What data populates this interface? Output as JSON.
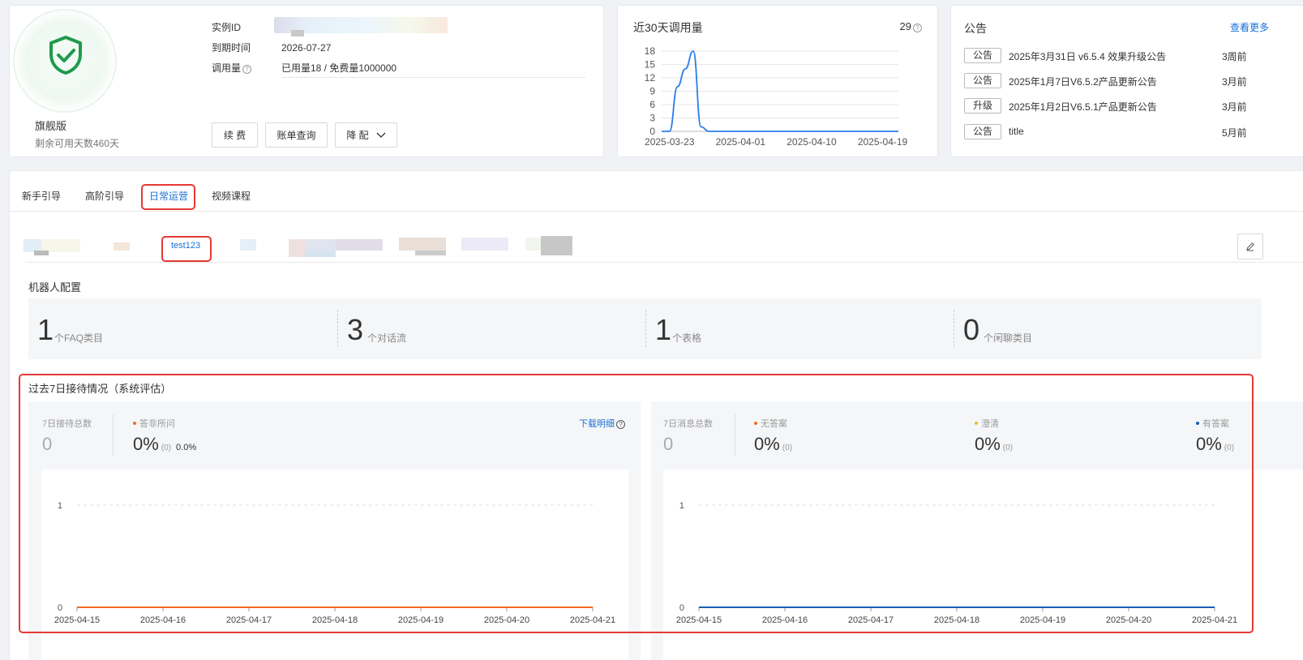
{
  "instance": {
    "edition": "旗舰版",
    "remaining_days": "剩余可用天数460天",
    "id_label": "实例ID",
    "expire_label": "到期时间",
    "expire_value": "2026-07-27",
    "usage_label": "调用量",
    "usage_value": "已用量18 / 免费量1000000",
    "renew_button": "续 费",
    "bill_button": "账单查询",
    "downgrade_button": "降 配"
  },
  "usage": {
    "title": "近30天调用量",
    "total": "29",
    "chart_data": {
      "type": "line",
      "x_ticks": [
        "2025-03-23",
        "2025-04-01",
        "2025-04-10",
        "2025-04-19"
      ],
      "y_ticks": [
        0,
        3,
        6,
        9,
        12,
        15,
        18
      ],
      "ylim": [
        0,
        18
      ],
      "xlim": [
        "2025-03-22",
        "2025-04-21"
      ],
      "x": [
        "2025-03-22",
        "2025-03-23",
        "2025-03-24",
        "2025-03-25",
        "2025-03-26",
        "2025-03-27",
        "2025-03-28",
        "2025-04-01",
        "2025-04-10",
        "2025-04-19",
        "2025-04-21"
      ],
      "values": [
        0,
        0,
        10,
        14,
        18,
        1,
        0,
        0,
        0,
        0,
        0
      ],
      "color": "#2b7de9",
      "grid": true
    }
  },
  "notice": {
    "title": "公告",
    "more": "查看更多",
    "items": [
      {
        "tag": "公告",
        "text": "2025年3月31日 v6.5.4 效果升级公告",
        "time": "3周前"
      },
      {
        "tag": "公告",
        "text": "2025年1月7日V6.5.2产品更新公告",
        "time": "3月前"
      },
      {
        "tag": "升级",
        "text": "2025年1月2日V6.5.1产品更新公告",
        "time": "3月前"
      },
      {
        "tag": "公告",
        "text": "title",
        "time": "5月前"
      }
    ]
  },
  "tabs": [
    "新手引导",
    "高阶引导",
    "日常运营",
    "视频课程"
  ],
  "active_subtab": "test123",
  "robot_config": {
    "title": "机器人配置",
    "stats": [
      {
        "num": "1",
        "label": "个FAQ类目"
      },
      {
        "num": "3",
        "label": "个对话流"
      },
      {
        "num": "1",
        "label": "个表格"
      },
      {
        "num": "0",
        "label": "个闲聊类目"
      }
    ]
  },
  "reception": {
    "title": "过去7日接待情况（系统评估）",
    "left": {
      "total_label": "7日接待总数",
      "total_value": "0",
      "metric_label": "答非所问",
      "metric_value": "0%",
      "metric_count": "(0)",
      "metric_extra": "0.0%",
      "download": "下载明细",
      "accent": "#f36c21"
    },
    "right": {
      "total_label": "7日消息总数",
      "total_value": "0",
      "metrics": [
        {
          "label": "无答案",
          "value": "0%",
          "count": "(0)",
          "color": "#f36c21"
        },
        {
          "label": "澄清",
          "value": "0%",
          "count": "(0)",
          "color": "#f5b82e"
        },
        {
          "label": "有答案",
          "value": "0%",
          "count": "(0)",
          "color": "#1a5fb4"
        }
      ]
    },
    "chart_data": [
      {
        "type": "line",
        "categories": [
          "2025-04-15",
          "2025-04-16",
          "2025-04-17",
          "2025-04-18",
          "2025-04-19",
          "2025-04-20",
          "2025-04-21"
        ],
        "values": [
          0,
          0,
          0,
          0,
          0,
          0,
          0
        ],
        "y_ticks": [
          0,
          1
        ],
        "ylim": [
          0,
          1
        ],
        "color": "#f36c21"
      },
      {
        "type": "line",
        "categories": [
          "2025-04-15",
          "2025-04-16",
          "2025-04-17",
          "2025-04-18",
          "2025-04-19",
          "2025-04-20",
          "2025-04-21"
        ],
        "values": [
          0,
          0,
          0,
          0,
          0,
          0,
          0
        ],
        "y_ticks": [
          0,
          1
        ],
        "ylim": [
          0,
          1
        ],
        "color": "#1a5fb4"
      }
    ]
  }
}
